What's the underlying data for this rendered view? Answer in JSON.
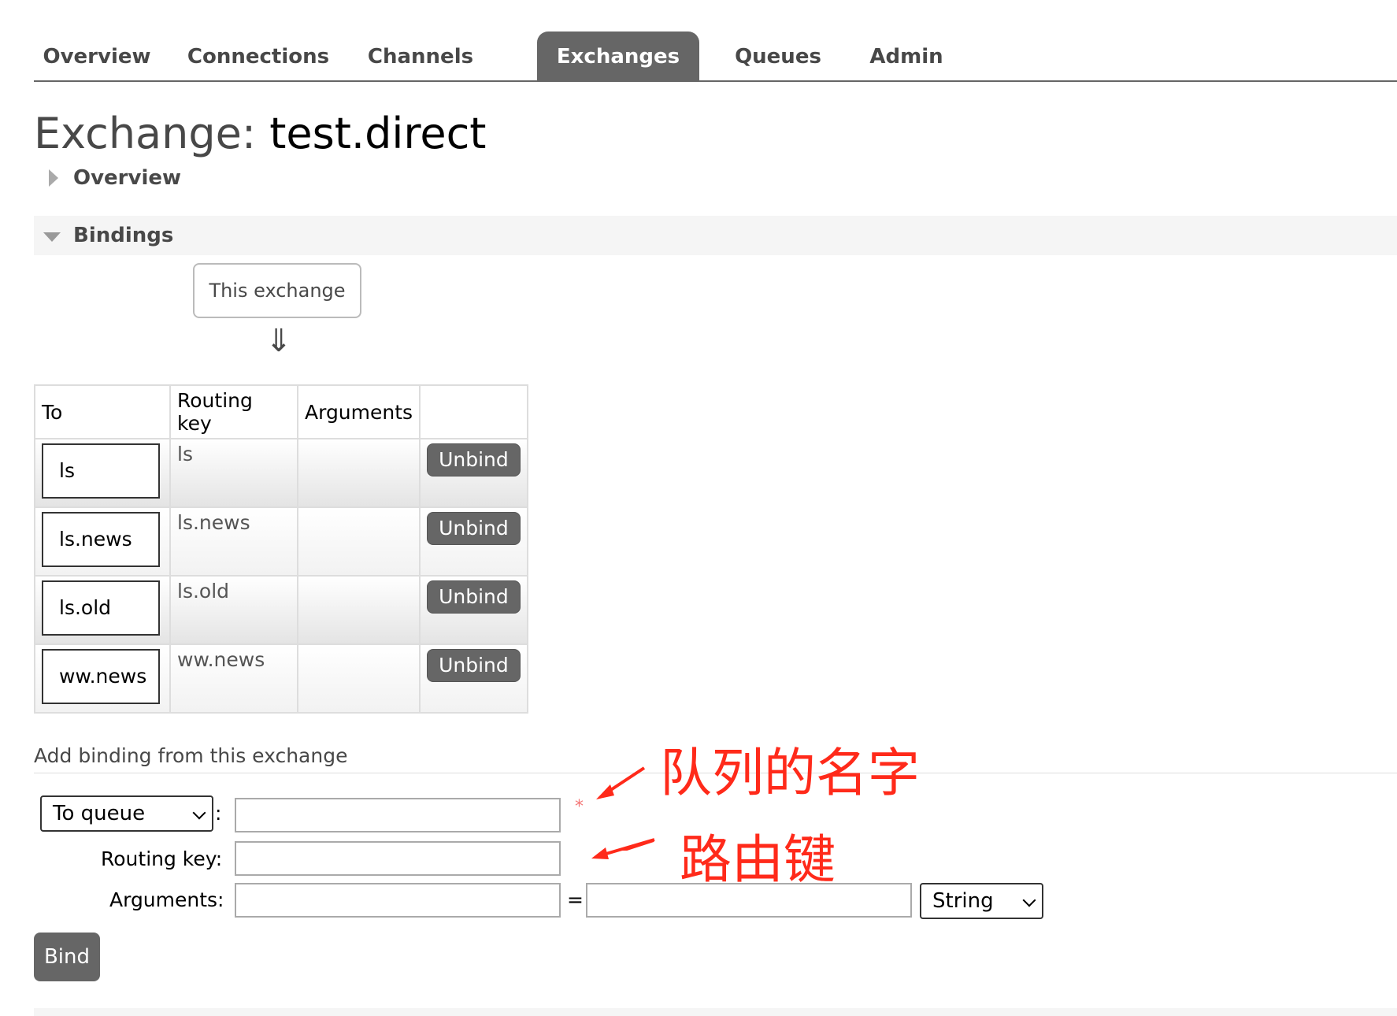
{
  "nav": {
    "tabs": [
      {
        "label": "Overview",
        "active": false
      },
      {
        "label": "Connections",
        "active": false
      },
      {
        "label": "Channels",
        "active": false
      },
      {
        "label": "Exchanges",
        "active": true
      },
      {
        "label": "Queues",
        "active": false
      },
      {
        "label": "Admin",
        "active": false
      }
    ]
  },
  "page": {
    "title_prefix": "Exchange:",
    "exchange_name": "test.direct"
  },
  "sections": {
    "overview": "Overview",
    "bindings": "Bindings"
  },
  "bindings": {
    "source_box": "This exchange",
    "arrow": "⇓",
    "headers": [
      "To",
      "Routing key",
      "Arguments",
      ""
    ],
    "rows": [
      {
        "to": "ls",
        "routing_key": "ls",
        "arguments": "",
        "action": "Unbind"
      },
      {
        "to": "ls.news",
        "routing_key": "ls.news",
        "arguments": "",
        "action": "Unbind"
      },
      {
        "to": "ls.old",
        "routing_key": "ls.old",
        "arguments": "",
        "action": "Unbind"
      },
      {
        "to": "ww.news",
        "routing_key": "ww.news",
        "arguments": "",
        "action": "Unbind"
      }
    ]
  },
  "add_binding": {
    "title": "Add binding from this exchange",
    "destination_type": "To queue",
    "destination_suffix": ":",
    "required_marker": "*",
    "routing_key_label": "Routing key:",
    "arguments_label": "Arguments:",
    "equals": "=",
    "arg_type": "String",
    "destination_value": "",
    "routing_key_value": "",
    "arg_key_value": "",
    "arg_value_value": "",
    "bind_label": "Bind"
  },
  "annotations": {
    "queue_name": "队列的名字",
    "routing_key": "路由键",
    "color": "#ff2a1a"
  },
  "colors": {
    "accent": "#666666",
    "text": "#484848"
  }
}
